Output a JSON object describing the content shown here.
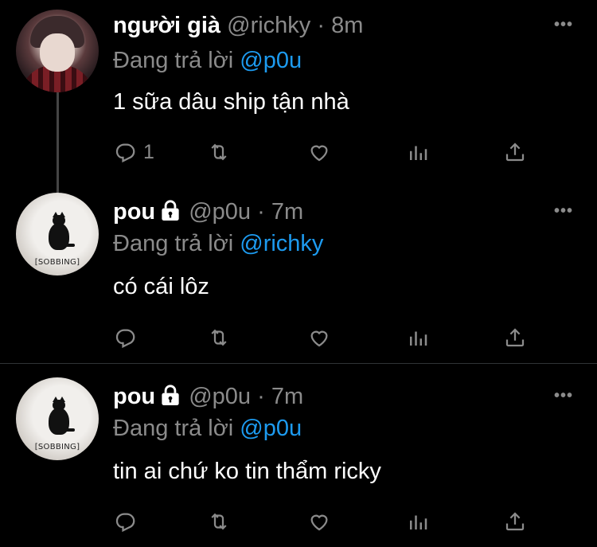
{
  "tweets": [
    {
      "display_name": "người già",
      "handle": "@richky",
      "dot": "·",
      "time": "8m",
      "reply_prefix": "Đang trả lời",
      "reply_to": "@p0u",
      "text": "1 sữa dâu ship tận nhà",
      "reply_count": "1",
      "locked": false
    },
    {
      "display_name": "pou",
      "handle": "@p0u",
      "dot": "·",
      "time": "7m",
      "reply_prefix": "Đang trả lời",
      "reply_to": "@richky",
      "text": "có cái lôz",
      "reply_count": "",
      "avatar_caption": "[SOBBING]",
      "locked": true
    },
    {
      "display_name": "pou",
      "handle": "@p0u",
      "dot": "·",
      "time": "7m",
      "reply_prefix": "Đang trả lời",
      "reply_to": "@p0u",
      "text": "tin ai chứ ko tin thẩm ricky",
      "reply_count": "",
      "avatar_caption": "[SOBBING]",
      "locked": true
    }
  ],
  "more_label": "•••",
  "icons": [
    "reply-icon",
    "retweet-icon",
    "like-icon",
    "stats-icon",
    "share-icon",
    "lock-icon",
    "more-icon"
  ],
  "colors": {
    "background": "#000000",
    "text": "#ffffff",
    "muted": "#8b8b8b",
    "mention": "#1d9bf0"
  }
}
